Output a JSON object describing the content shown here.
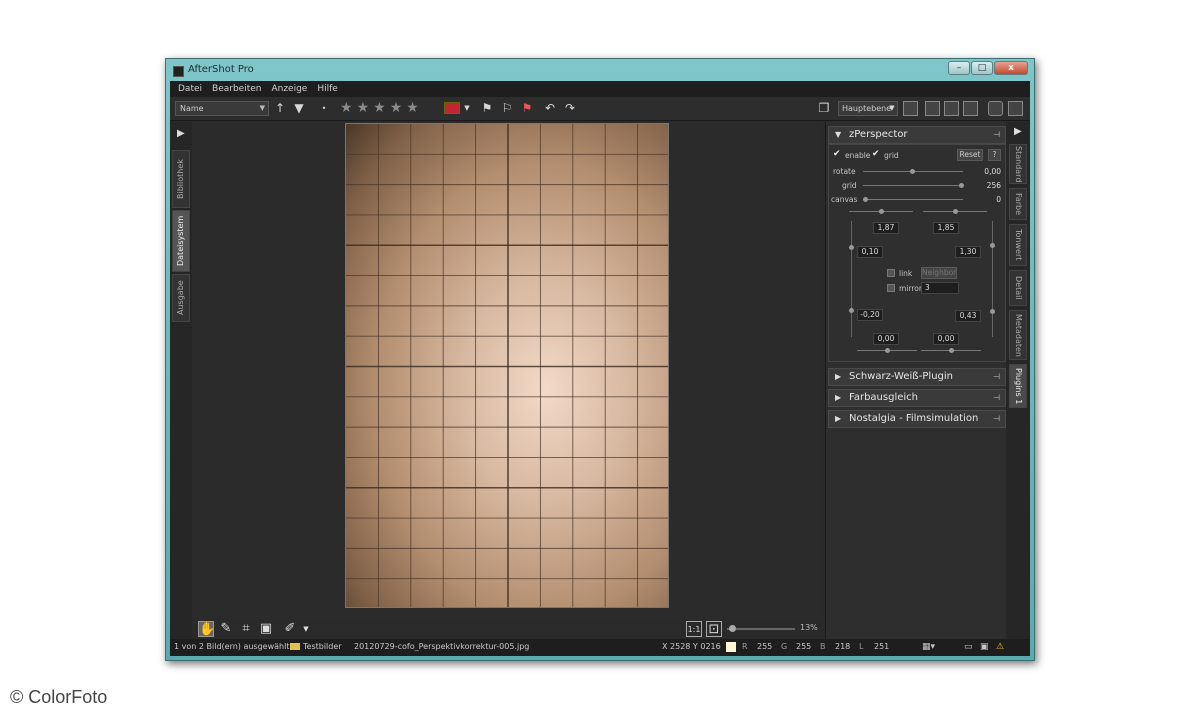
{
  "window": {
    "title": "AfterShot Pro",
    "controls": {
      "minimize": "–",
      "maximize": "□",
      "close": "x"
    }
  },
  "menu": [
    "Datei",
    "Bearbeiten",
    "Anzeige",
    "Hilfe"
  ],
  "toolbar": {
    "sort_value": "Name",
    "rating_stars": 5,
    "color_label": "#c0262e",
    "layer_select": "Hauptebene"
  },
  "left_tabs": [
    "Bibliothek",
    "Dateisystem",
    "Ausgabe"
  ],
  "left_tabs_active": "Dateisystem",
  "right_tabs": [
    "Standard",
    "Farbe",
    "Tonwert",
    "Detail",
    "Metadaten",
    "Plugins 1"
  ],
  "right_tabs_active": "Plugins 1",
  "panels": {
    "zperspector": {
      "title": "zPerspector",
      "enable_label": "enable",
      "grid_check_label": "grid",
      "reset_label": "Reset",
      "help_label": "?",
      "rotate_label": "rotate",
      "rotate_value": "0,00",
      "grid_label": "grid",
      "grid_value": "256",
      "canvas_label": "canvas",
      "canvas_value": "0",
      "top_left": "1,87",
      "top_right": "1,85",
      "mid_left": "0,10",
      "mid_right": "1,30",
      "link_label": "link",
      "neighbor_label": "Neighbor",
      "mirror_label": "mirror",
      "mirror_value": "3",
      "low_left": "-0,20",
      "low_right": "0,43",
      "bottom_left": "0,00",
      "bottom_right": "0,00"
    },
    "collapsed": [
      "Schwarz-Weiß-Plugin",
      "Farbausgleich",
      "Nostalgia - Filmsimulation"
    ]
  },
  "canvas": {
    "zoom": "13%"
  },
  "status": {
    "selection": "1 von 2 Bild(ern) ausgewählt",
    "folder": "Testbilder",
    "filename": "20120729-cofo_Perspektivkorrektur-005.jpg",
    "coords": "X 2528  Y 0216",
    "r_label": "R",
    "r_value": "255",
    "g_label": "G",
    "g_value": "255",
    "b_label": "B",
    "b_value": "218",
    "l_label": "L",
    "l_value": "251"
  },
  "credit": "© ColorFoto"
}
